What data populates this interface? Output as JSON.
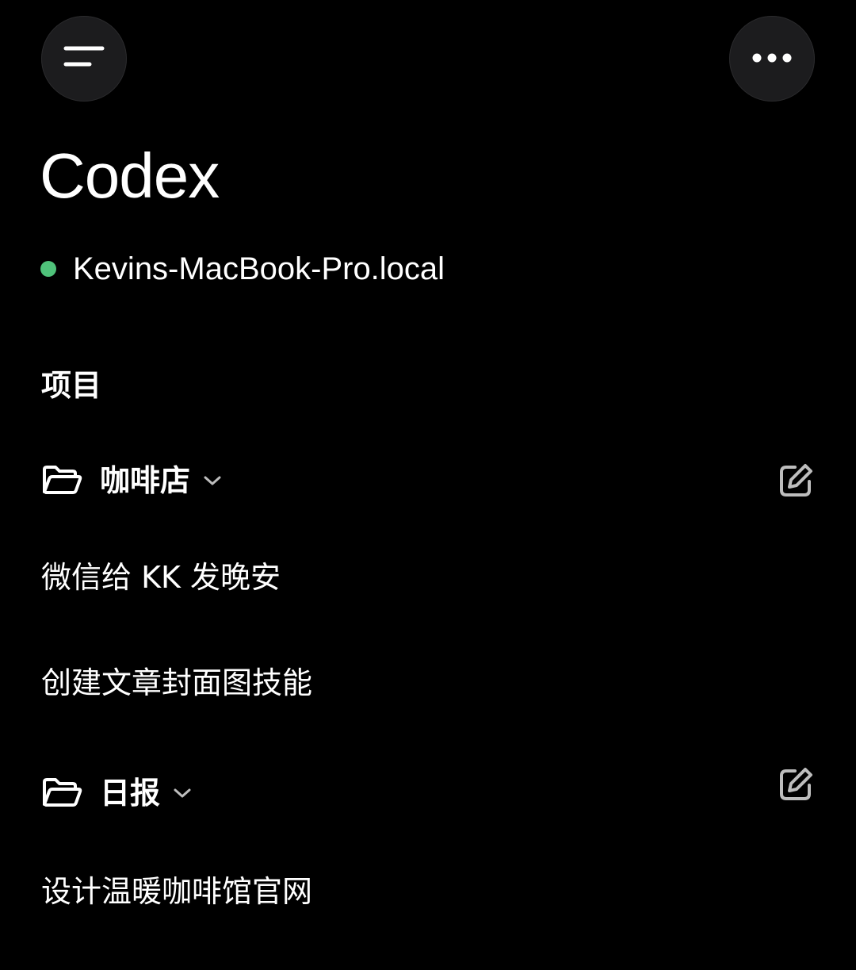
{
  "app": {
    "title": "Codex"
  },
  "connection": {
    "host": "Kevins-MacBook-Pro.local",
    "status_color": "#4fc27a"
  },
  "header": {
    "menu_icon": "menu-icon",
    "more_icon": "more-horizontal-icon"
  },
  "section": {
    "label": "项目"
  },
  "projects": [
    {
      "name": "咖啡店",
      "icons": [
        "folder-open-icon",
        "chevron-down-icon",
        "edit-icon"
      ],
      "threads": [
        "微信给 KK 发晚安",
        "创建文章封面图技能"
      ]
    },
    {
      "name": "日报",
      "icons": [
        "folder-open-icon",
        "chevron-down-icon",
        "edit-icon"
      ],
      "threads": [
        "设计温暖咖啡馆官网"
      ]
    }
  ],
  "colors": {
    "background": "#000000",
    "button_bg": "#1c1c1e",
    "text": "#ffffff",
    "icon_muted": "#bdbdbd"
  }
}
